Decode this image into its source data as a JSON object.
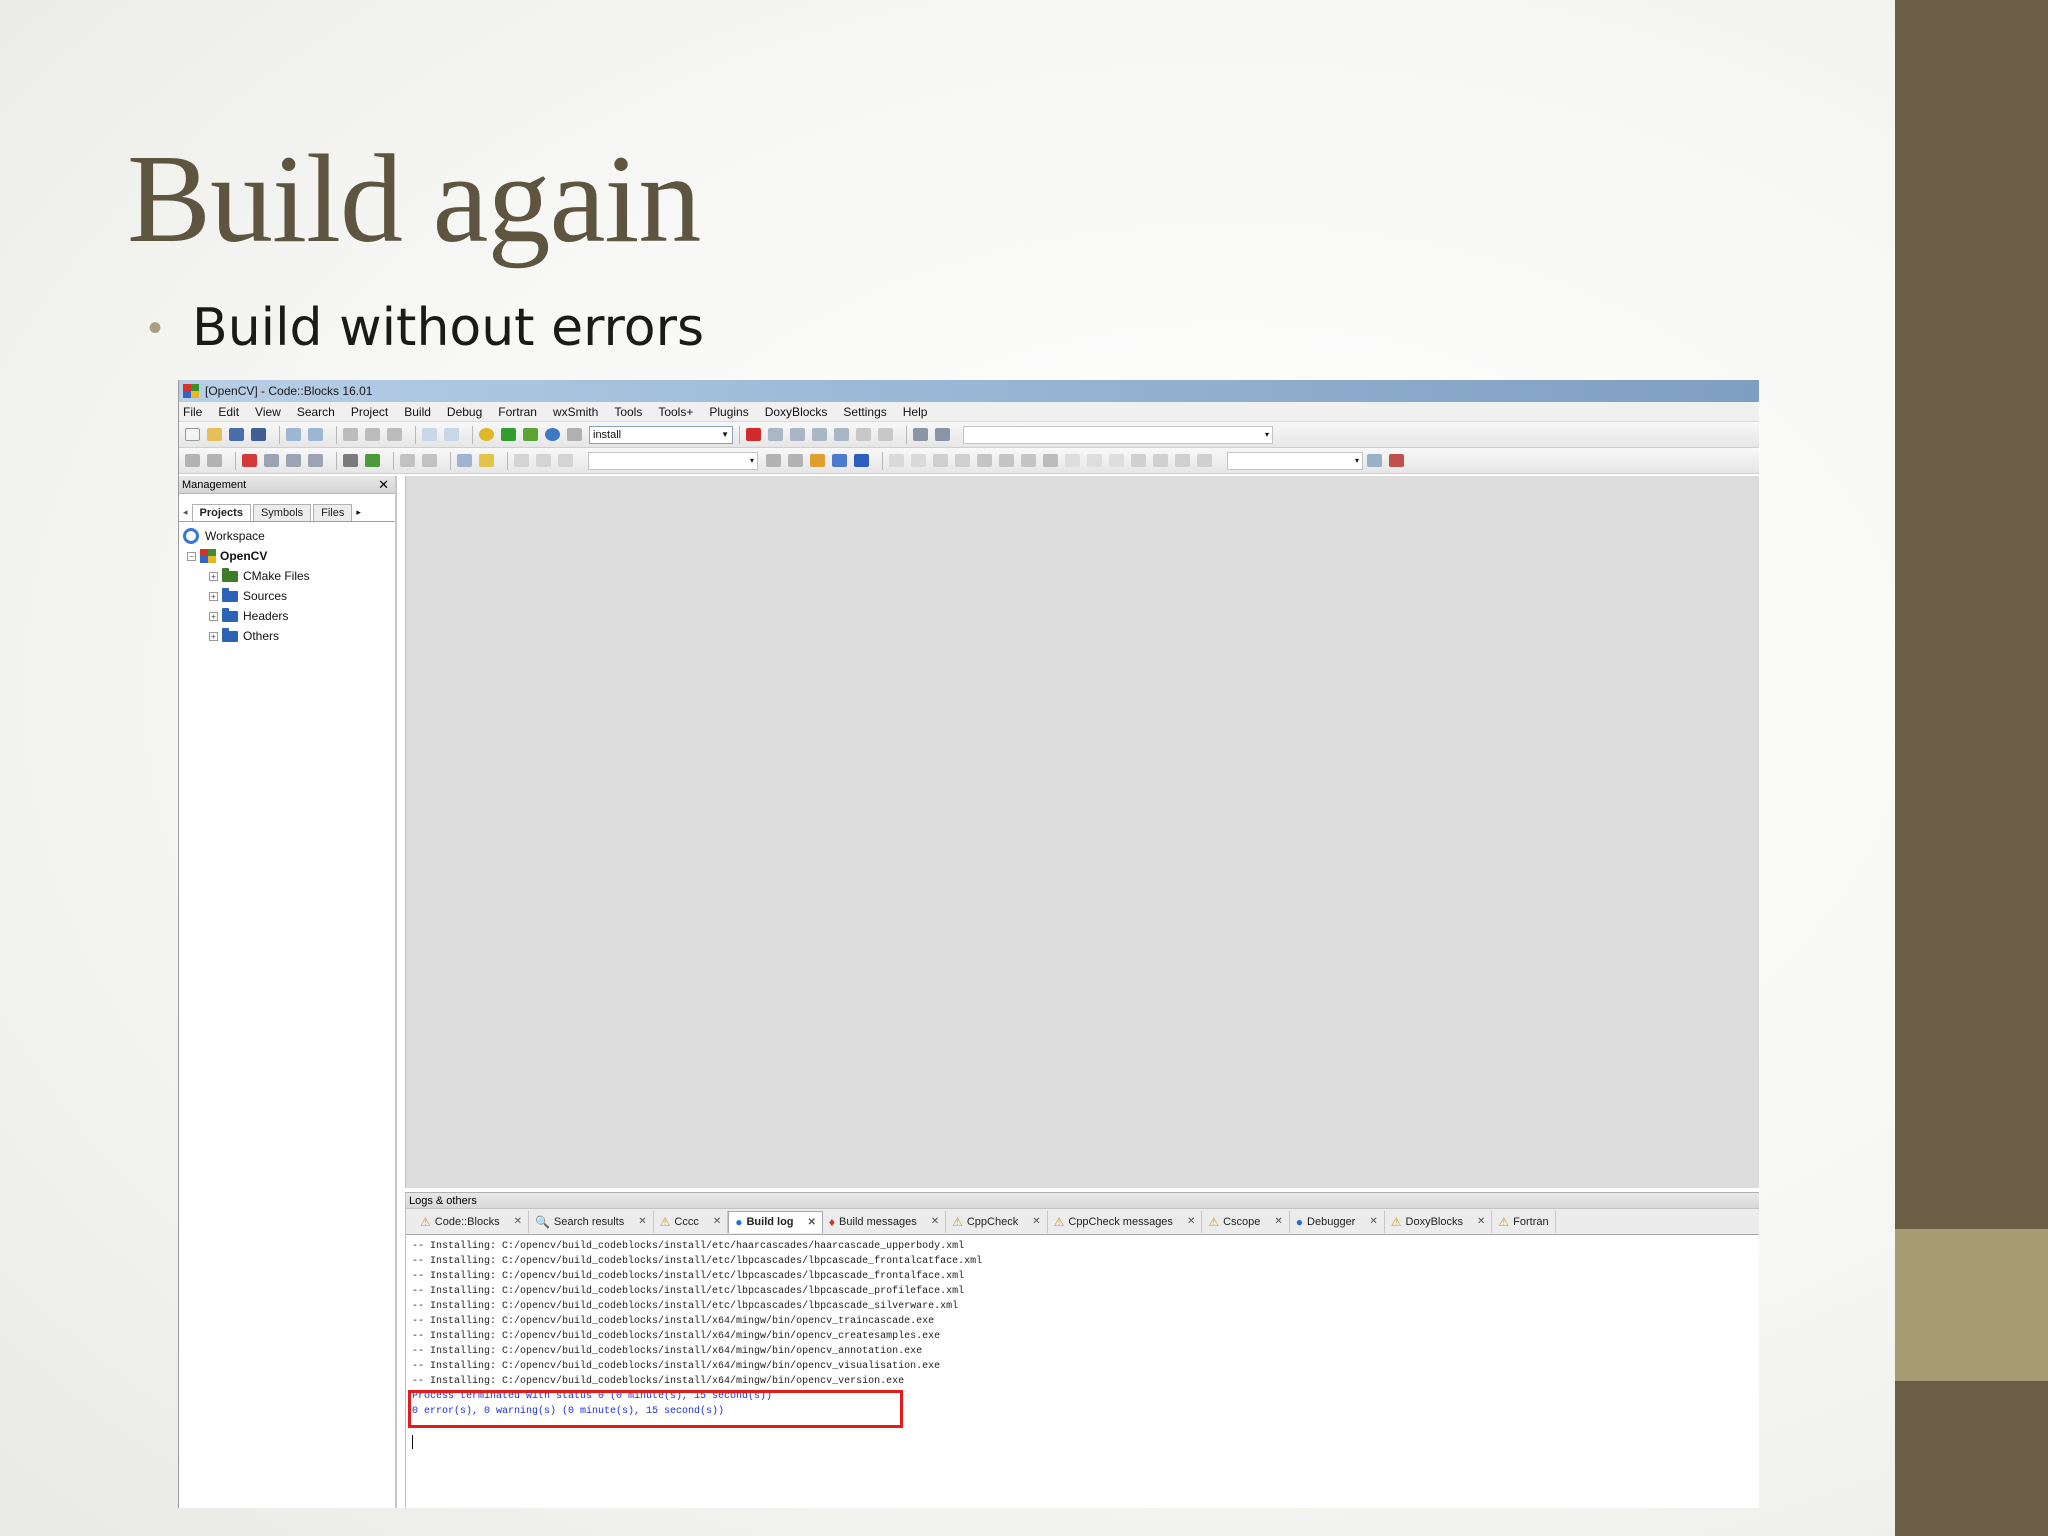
{
  "slide": {
    "title": "Build again",
    "bullet": "Build without errors",
    "colors": {
      "title": "#5e5540",
      "band": "#6b5e46",
      "band_accent": "#a69c74",
      "bullet_dot": "#a8a080"
    }
  },
  "window": {
    "title": "[OpenCV] - Code::Blocks 16.01",
    "menu": [
      "File",
      "Edit",
      "View",
      "Search",
      "Project",
      "Build",
      "Debug",
      "Fortran",
      "wxSmith",
      "Tools",
      "Tools+",
      "Plugins",
      "DoxyBlocks",
      "Settings",
      "Help"
    ],
    "build_target": "install",
    "icons": [
      "new-file-icon",
      "open-icon",
      "save-icon",
      "save-all-icon",
      "undo-icon",
      "redo-icon",
      "cut-icon",
      "copy-icon",
      "paste-icon",
      "find-icon",
      "replace-icon",
      "build-icon",
      "run-icon",
      "build-run-icon",
      "rebuild-icon",
      "abort-icon",
      "debug-icon",
      "step-icon",
      "stop-debug-icon"
    ]
  },
  "management": {
    "title": "Management",
    "close": "✕",
    "tabs": [
      "Projects",
      "Symbols",
      "Files"
    ],
    "tree": {
      "workspace": "Workspace",
      "project": "OpenCV",
      "folders": [
        "CMake Files",
        "Sources",
        "Headers",
        "Others"
      ]
    }
  },
  "logs": {
    "title": "Logs & others",
    "tabs": [
      "Code::Blocks",
      "Search results",
      "Cccc",
      "Build log",
      "Build messages",
      "CppCheck",
      "CppCheck messages",
      "Cscope",
      "Debugger",
      "DoxyBlocks",
      "Fortran"
    ],
    "active_tab": "Build log",
    "lines": [
      "-- Installing: C:/opencv/build_codeblocks/install/etc/haarcascades/haarcascade_upperbody.xml",
      "-- Installing: C:/opencv/build_codeblocks/install/etc/lbpcascades/lbpcascade_frontalcatface.xml",
      "-- Installing: C:/opencv/build_codeblocks/install/etc/lbpcascades/lbpcascade_frontalface.xml",
      "-- Installing: C:/opencv/build_codeblocks/install/etc/lbpcascades/lbpcascade_profileface.xml",
      "-- Installing: C:/opencv/build_codeblocks/install/etc/lbpcascades/lbpcascade_silverware.xml",
      "-- Installing: C:/opencv/build_codeblocks/install/x64/mingw/bin/opencv_traincascade.exe",
      "-- Installing: C:/opencv/build_codeblocks/install/x64/mingw/bin/opencv_createsamples.exe",
      "-- Installing: C:/opencv/build_codeblocks/install/x64/mingw/bin/opencv_annotation.exe",
      "-- Installing: C:/opencv/build_codeblocks/install/x64/mingw/bin/opencv_visualisation.exe",
      "-- Installing: C:/opencv/build_codeblocks/install/x64/mingw/bin/opencv_version.exe"
    ],
    "status_lines": [
      "Process terminated with status 0 (0 minute(s), 15 second(s))",
      "0 error(s), 0 warning(s) (0 minute(s), 15 second(s))"
    ],
    "highlight_color": "#e21b1b"
  }
}
